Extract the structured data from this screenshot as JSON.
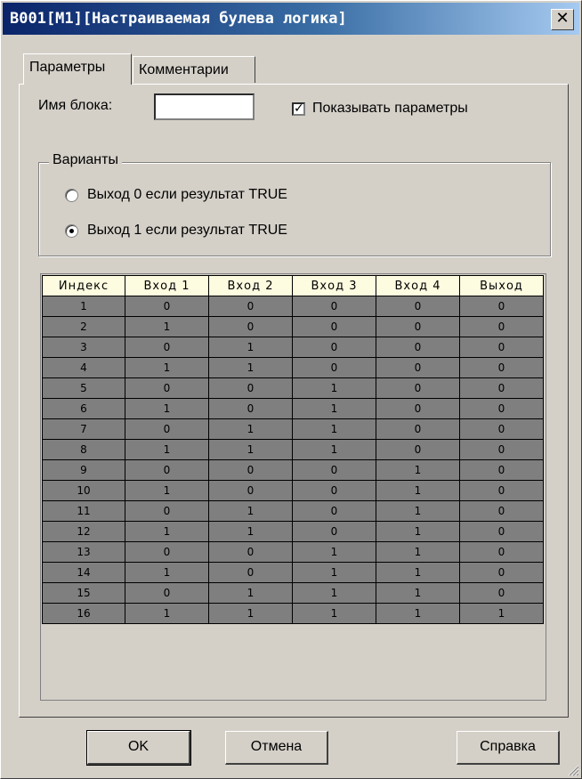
{
  "window": {
    "title": "B001[M1][Настраиваемая булева логика]",
    "close_symbol": "✕"
  },
  "tabs": [
    {
      "label": "Параметры",
      "active": true
    },
    {
      "label": "Комментарии",
      "active": false
    }
  ],
  "params": {
    "block_name_label": "Имя блока:",
    "block_name_value": "",
    "show_params_label": "Показывать параметры",
    "show_params_checked": true,
    "check_mark": "✓"
  },
  "variants": {
    "legend": "Варианты",
    "options": [
      {
        "label": "Выход 0 если результат TRUE",
        "selected": false
      },
      {
        "label": "Выход 1 если результат TRUE",
        "selected": true
      }
    ]
  },
  "truth_table": {
    "headers": [
      "Индекс",
      "Вход 1",
      "Вход 2",
      "Вход 3",
      "Вход 4",
      "Выход"
    ],
    "rows": [
      [
        "1",
        "0",
        "0",
        "0",
        "0",
        "0"
      ],
      [
        "2",
        "1",
        "0",
        "0",
        "0",
        "0"
      ],
      [
        "3",
        "0",
        "1",
        "0",
        "0",
        "0"
      ],
      [
        "4",
        "1",
        "1",
        "0",
        "0",
        "0"
      ],
      [
        "5",
        "0",
        "0",
        "1",
        "0",
        "0"
      ],
      [
        "6",
        "1",
        "0",
        "1",
        "0",
        "0"
      ],
      [
        "7",
        "0",
        "1",
        "1",
        "0",
        "0"
      ],
      [
        "8",
        "1",
        "1",
        "1",
        "0",
        "0"
      ],
      [
        "9",
        "0",
        "0",
        "0",
        "1",
        "0"
      ],
      [
        "10",
        "1",
        "0",
        "0",
        "1",
        "0"
      ],
      [
        "11",
        "0",
        "1",
        "0",
        "1",
        "0"
      ],
      [
        "12",
        "1",
        "1",
        "0",
        "1",
        "0"
      ],
      [
        "13",
        "0",
        "0",
        "1",
        "1",
        "0"
      ],
      [
        "14",
        "1",
        "0",
        "1",
        "1",
        "0"
      ],
      [
        "15",
        "0",
        "1",
        "1",
        "1",
        "0"
      ],
      [
        "16",
        "1",
        "1",
        "1",
        "1",
        "1"
      ]
    ],
    "colors": {
      "header_bg": "#fdfbe0",
      "cell_bg": "#7f7f7f"
    }
  },
  "buttons": {
    "ok": "OK",
    "cancel": "Отмена",
    "help": "Справка"
  },
  "icons": {
    "close": "close-icon",
    "checkbox": "checkmark-icon",
    "resize": "resize-grip-icon"
  }
}
